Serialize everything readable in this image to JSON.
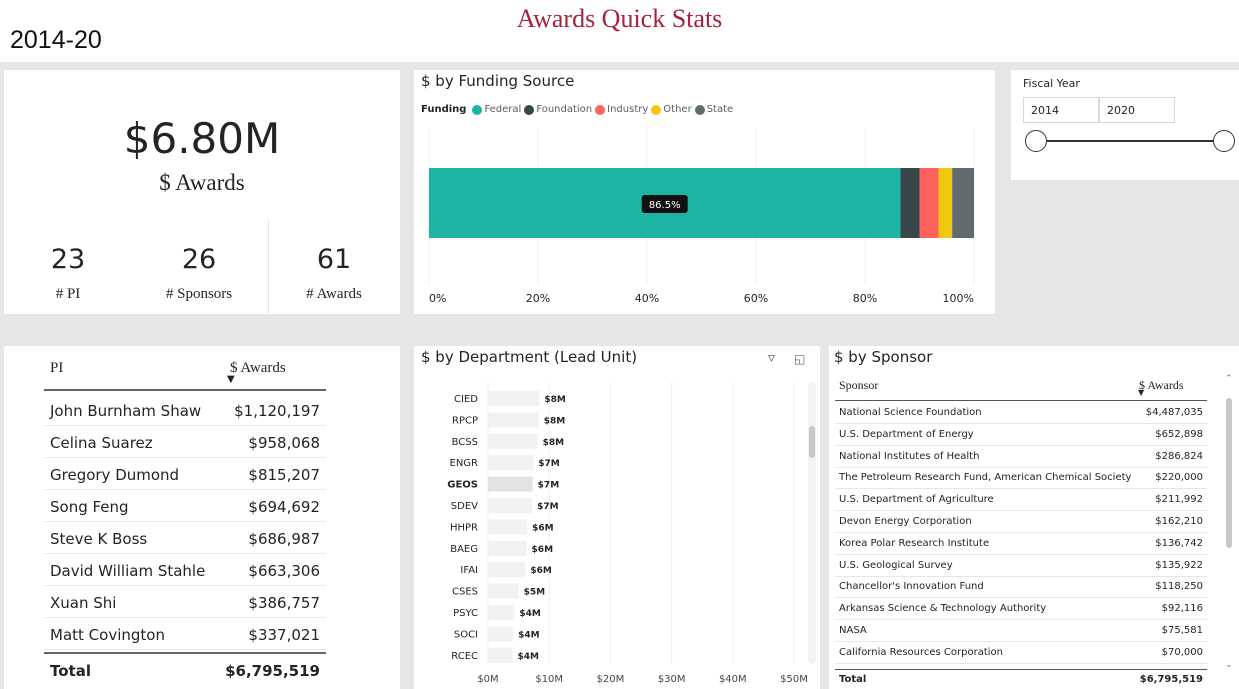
{
  "header": {
    "title": "Awards Quick Stats",
    "date_range": "2014-20"
  },
  "kpi": {
    "total": "$6.80M",
    "total_label": "$ Awards",
    "items": [
      {
        "value": "23",
        "label": "# PI"
      },
      {
        "value": "26",
        "label": "# Sponsors"
      },
      {
        "value": "61",
        "label": "# Awards"
      }
    ]
  },
  "funding": {
    "title": "$ by Funding Source",
    "legend_title": "Funding",
    "legend": [
      {
        "name": "Federal",
        "color": "#1db4a4"
      },
      {
        "name": "Foundation",
        "color": "#374649"
      },
      {
        "name": "Industry",
        "color": "#fd625e"
      },
      {
        "name": "Other",
        "color": "#f2c80f"
      },
      {
        "name": "State",
        "color": "#5f6b6d"
      }
    ],
    "tooltip": "86.5%",
    "axis_ticks": [
      "0%",
      "20%",
      "40%",
      "60%",
      "80%",
      "100%"
    ]
  },
  "fiscal_year": {
    "title": "Fiscal Year",
    "start": "2014",
    "end": "2020"
  },
  "pi_table": {
    "header_pi": "PI",
    "header_awards": "$ Awards",
    "rows": [
      {
        "name": "John Burnham Shaw",
        "value": "$1,120,197"
      },
      {
        "name": "Celina Suarez",
        "value": "$958,068"
      },
      {
        "name": "Gregory Dumond",
        "value": "$815,207"
      },
      {
        "name": "Song Feng",
        "value": "$694,692"
      },
      {
        "name": "Steve K Boss",
        "value": "$686,987"
      },
      {
        "name": "David William Stahle",
        "value": "$663,306"
      },
      {
        "name": "Xuan Shi",
        "value": "$386,757"
      },
      {
        "name": "Matt Covington",
        "value": "$337,021"
      }
    ],
    "total_label": "Total",
    "total_value": "$6,795,519"
  },
  "department": {
    "title": "$ by Department (Lead Unit)",
    "filter_icon": "filter-icon",
    "focus_icon": "focus-mode-icon",
    "axis_ticks": [
      "$0M",
      "$10M",
      "$20M",
      "$30M",
      "$40M",
      "$50M"
    ],
    "labels": [
      "$8M",
      "$8M",
      "$8M",
      "$7M",
      "$7M",
      "$7M",
      "$6M",
      "$6M",
      "$6M",
      "$5M",
      "$4M",
      "$4M",
      "$4M"
    ]
  },
  "sponsor_table": {
    "title": "$ by Sponsor",
    "header_sponsor": "Sponsor",
    "header_awards": "$ Awards",
    "rows": [
      {
        "name": "National Science Foundation",
        "value": "$4,487,035"
      },
      {
        "name": "U.S. Department of Energy",
        "value": "$652,898"
      },
      {
        "name": "National Institutes of Health",
        "value": "$286,824"
      },
      {
        "name": "The Petroleum Research Fund, American Chemical Society",
        "value": "$220,000"
      },
      {
        "name": "U.S. Department of Agriculture",
        "value": "$211,992"
      },
      {
        "name": "Devon Energy Corporation",
        "value": "$162,210"
      },
      {
        "name": "Korea Polar Research Institute",
        "value": "$136,742"
      },
      {
        "name": "U.S. Geological Survey",
        "value": "$135,922"
      },
      {
        "name": "Chancellor's Innovation Fund",
        "value": "$118,250"
      },
      {
        "name": "Arkansas Science & Technology Authority",
        "value": "$92,116"
      },
      {
        "name": "NASA",
        "value": "$75,581"
      },
      {
        "name": "California Resources Corporation",
        "value": "$70,000"
      }
    ],
    "total_label": "Total",
    "total_value": "$6,795,519"
  },
  "chart_data": [
    {
      "type": "bar",
      "title": "$ by Funding Source",
      "orientation": "horizontal-stacked-100",
      "categories": [
        ""
      ],
      "series": [
        {
          "name": "Federal",
          "values": [
            86.5
          ]
        },
        {
          "name": "Foundation",
          "values": [
            3.5
          ]
        },
        {
          "name": "Industry",
          "values": [
            3.5
          ]
        },
        {
          "name": "Other",
          "values": [
            2.5
          ]
        },
        {
          "name": "State",
          "values": [
            4.0
          ]
        }
      ],
      "xlim": [
        0,
        100
      ],
      "legend": "top-left",
      "grid": true
    },
    {
      "type": "bar",
      "title": "$ by Department (Lead Unit)",
      "orientation": "horizontal",
      "categories": [
        "CIED",
        "RPCP",
        "BCSS",
        "ENGR",
        "GEOS",
        "SDEV",
        "HHPR",
        "BAEG",
        "IFAI",
        "CSES",
        "PSYC",
        "SOCI",
        "RCEC"
      ],
      "values": [
        8.4,
        8.3,
        8.1,
        7.4,
        7.3,
        7.2,
        6.4,
        6.3,
        6.1,
        5.0,
        4.3,
        4.1,
        4.0
      ],
      "highlighted": "GEOS",
      "xlim": [
        0,
        50
      ],
      "grid": true
    }
  ]
}
